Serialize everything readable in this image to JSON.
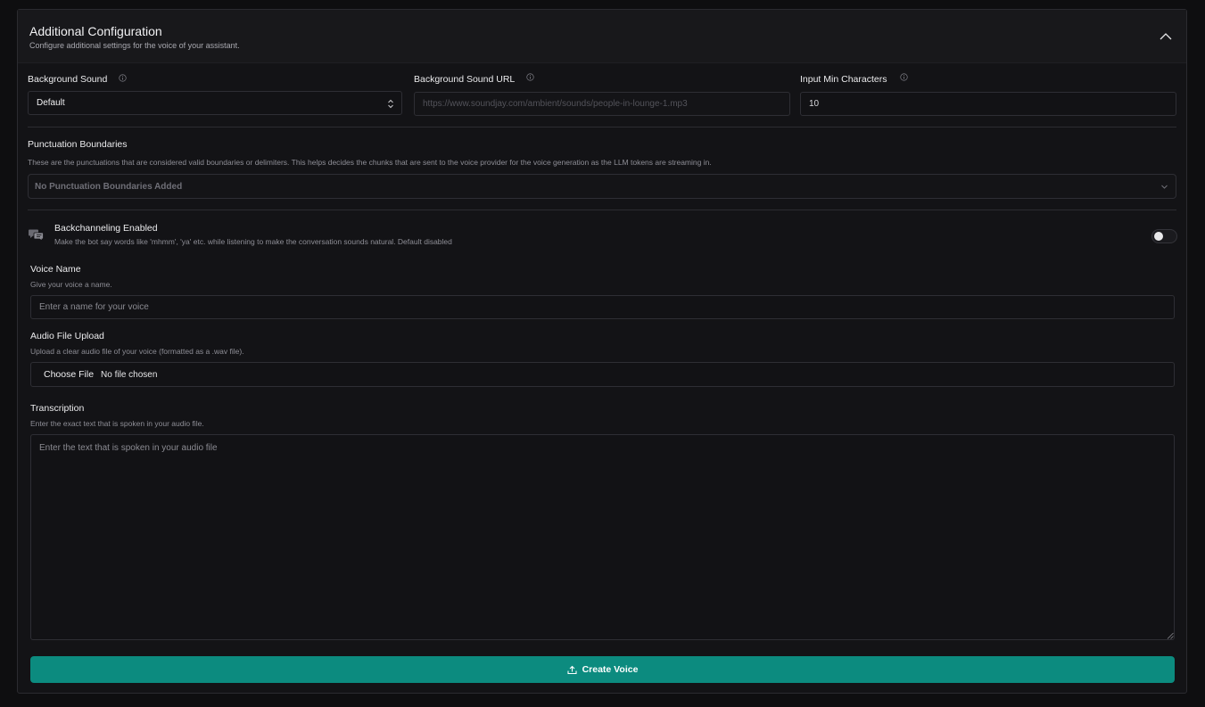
{
  "header": {
    "title": "Additional Configuration",
    "subtitle": "Configure additional settings for the voice of your assistant."
  },
  "background_sound": {
    "label": "Background Sound",
    "value": "Default"
  },
  "background_sound_url": {
    "label": "Background Sound URL",
    "placeholder": "https://www.soundjay.com/ambient/sounds/people-in-lounge-1.mp3"
  },
  "input_min_characters": {
    "label": "Input Min Characters",
    "value": "10"
  },
  "punctuation": {
    "label": "Punctuation Boundaries",
    "description": "These are the punctuations that are considered valid boundaries or delimiters. This helps decides the chunks that are sent to the voice provider for the voice generation as the LLM tokens are streaming in.",
    "value": "No Punctuation Boundaries Added"
  },
  "backchanneling": {
    "label": "Backchanneling Enabled",
    "description": "Make the bot say words like 'mhmm', 'ya' etc. while listening to make the conversation sounds natural. Default disabled",
    "enabled": false
  },
  "voice_name": {
    "label": "Voice Name",
    "description": "Give your voice a name.",
    "placeholder": "Enter a name for your voice"
  },
  "audio_upload": {
    "label": "Audio File Upload",
    "description": "Upload a clear audio file of your voice (formatted as a .wav file).",
    "button_label": "Choose File",
    "status": "No file chosen"
  },
  "transcription": {
    "label": "Transcription",
    "description": "Enter the exact text that is spoken in your audio file.",
    "placeholder": "Enter the text that is spoken in your audio file"
  },
  "create_button": {
    "label": "Create Voice"
  },
  "colors": {
    "accent": "#0c8b7f",
    "background": "#0e0e10",
    "panel": "#131316"
  },
  "icons": {
    "collapse": "chevron-up-icon",
    "info": "info-icon",
    "select": "select-arrows-icon",
    "dropdown": "chevron-down-icon",
    "backchannel": "chat-bubbles-icon",
    "upload": "upload-icon"
  }
}
